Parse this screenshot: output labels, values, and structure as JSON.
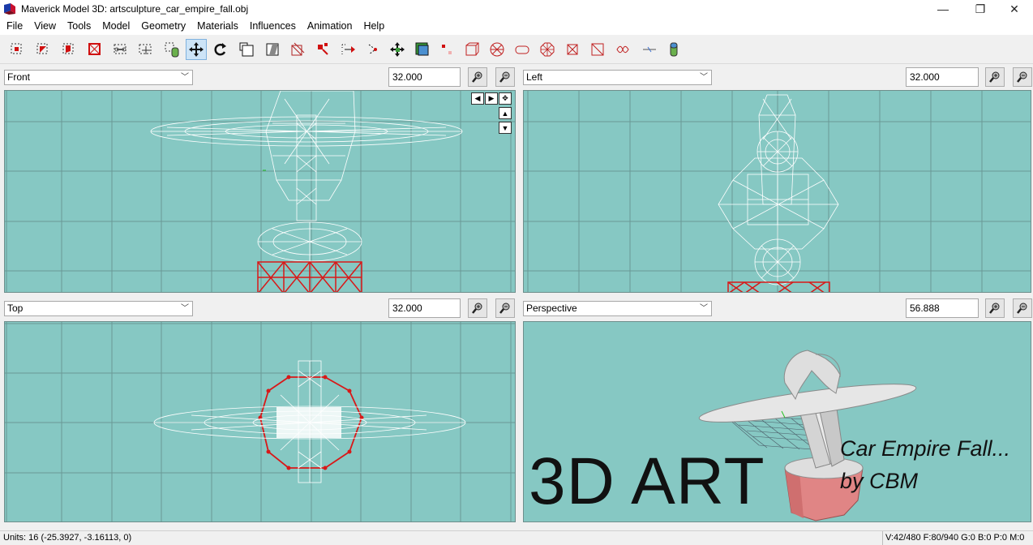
{
  "window": {
    "title": "Maverick Model 3D: artsculpture_car_empire_fall.obj",
    "minimize_glyph": "—",
    "maximize_glyph": "❐",
    "close_glyph": "✕"
  },
  "menu": [
    "File",
    "View",
    "Tools",
    "Model",
    "Geometry",
    "Materials",
    "Influences",
    "Animation",
    "Help"
  ],
  "toolbar": {
    "tools": [
      "select-vertices-icon",
      "select-faces-icon",
      "select-connected-icon",
      "select-groups-icon",
      "select-bone-joints-icon",
      "select-points-icon",
      "select-projections-icon",
      "move-icon",
      "rotate-icon",
      "scale-icon",
      "shear-icon",
      "extrude-icon",
      "add-vertex-icon",
      "create-rectangle-icon",
      "create-cube-icon",
      "create-bone-icon",
      "create-point-icon",
      "create-projection-icon",
      "attract-near-icon",
      "create-ellipsoid-icon",
      "create-cylinder-icon",
      "create-torus-icon",
      "create-polygon-icon",
      "background-icon",
      "paint-texture-icon"
    ],
    "active_tool": "move-icon"
  },
  "viewports": [
    {
      "id": "front",
      "view": "Front",
      "zoom": "32.000"
    },
    {
      "id": "left",
      "view": "Left",
      "zoom": "32.000"
    },
    {
      "id": "top",
      "view": "Top",
      "zoom": "32.000"
    },
    {
      "id": "perspective",
      "view": "Perspective",
      "zoom": "56.888"
    }
  ],
  "overlay": {
    "headline": "3D ART",
    "caption_line1": "Car Empire Fall...",
    "caption_line2": "by CBM"
  },
  "status": {
    "units": "Units: 16  (-25.3927, -3.16113, 0)",
    "counts": "V:42/480  F:80/940  G:0  B:0  P:0  M:0"
  },
  "colors": {
    "viewport_bg": "#86c8c3",
    "wire": "#ffffff",
    "base_wire": "#e02020",
    "active_tool_bg": "#cde4f7"
  }
}
